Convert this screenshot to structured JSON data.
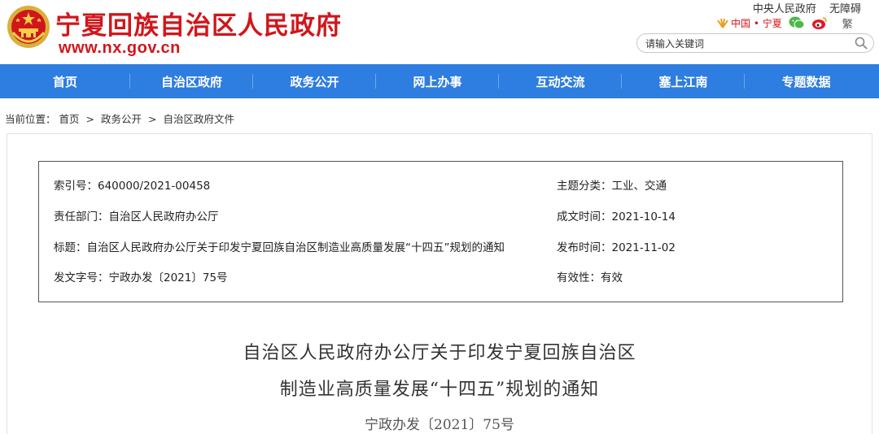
{
  "header": {
    "site_title": "宁夏回族自治区人民政府",
    "site_url": "www.nx.gov.cn",
    "top_links": [
      "中央人民政府",
      "无障碍"
    ],
    "region_link": "中国 • 宁夏",
    "traditional": "繁",
    "search_placeholder": "请输入关键词"
  },
  "nav": {
    "items": [
      "首页",
      "自治区政府",
      "政务公开",
      "网上办事",
      "互动交流",
      "塞上江南",
      "专题数据"
    ]
  },
  "breadcrumb": {
    "prefix": "当前位置：",
    "items": [
      "首页",
      "政务公开",
      "自治区政府文件"
    ],
    "separator": ">"
  },
  "meta": {
    "index_no": "索引号：640000/2021-00458",
    "department": "责任部门：自治区人民政府办公厅",
    "title": "标题：自治区人民政府办公厅关于印发宁夏回族自治区制造业高质量发展“十四五”规划的通知",
    "doc_code": "发文字号：宁政办发〔2021〕75号",
    "category": "主题分类：工业、交通",
    "created": "成文时间：2021-10-14",
    "published": "发布时间：2021-11-02",
    "validity": "有效性：有效"
  },
  "document": {
    "title_line1": "自治区人民政府办公厅关于印发宁夏回族自治区",
    "title_line2": "制造业高质量发展“十四五”规划的通知",
    "doc_no": "宁政办发〔2021〕75号"
  },
  "colors": {
    "brand_red": "#d1161b",
    "nav_blue": "#2e7de0"
  }
}
